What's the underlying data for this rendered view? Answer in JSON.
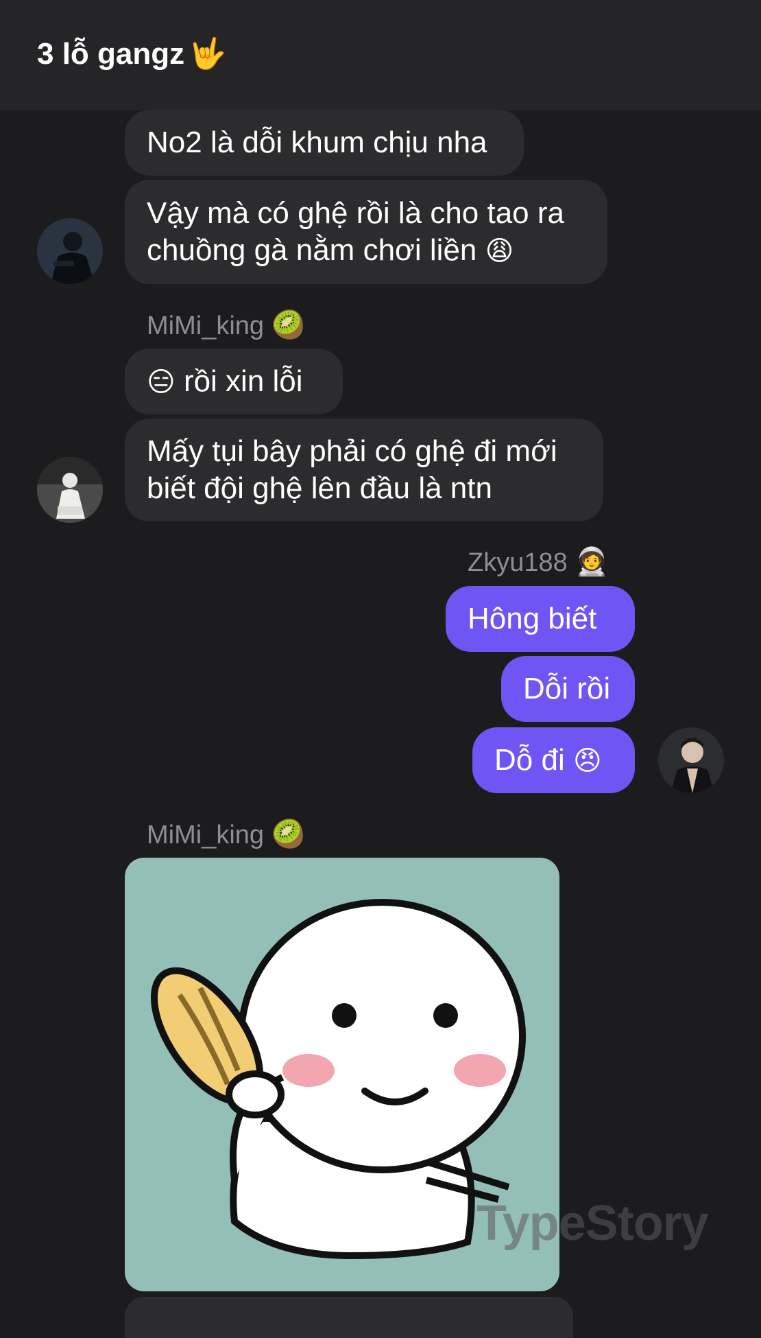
{
  "header": {
    "title": "3 lỗ gangz",
    "emoji": "🤟"
  },
  "messages": {
    "m1": "No2 là dỗi khum chịu nha",
    "m2_line1": "Vậy mà có ghệ rồi là cho tao ra",
    "m2_line2": "chuồng gà nằm chơi liền",
    "m2_emoji": "😩",
    "sender1": "MiMi_king",
    "sender1_emoji": "🥝",
    "m3_emoji": "😑",
    "m3_text": "rồi xin lỗi",
    "m4_line1": "Mấy tụi bây phải có ghệ đi mới",
    "m4_line2": "biết đội ghệ lên đầu là ntn",
    "sender2": "Zkyu188",
    "sender2_emoji": "🧑‍🚀",
    "m5": "Hông biết",
    "m6": "Dỗi rồi",
    "m7_text": "Dỗ đi",
    "m7_emoji": "😠",
    "sender3": "MiMi_king",
    "sender3_emoji": "🥝"
  },
  "watermark": "TypeStory",
  "colors": {
    "background": "#1c1c1e",
    "header": "#252527",
    "bubble": "#2c2c2e",
    "my_bubble": "#7055f5",
    "sticker_bg": "#94bfb8"
  }
}
